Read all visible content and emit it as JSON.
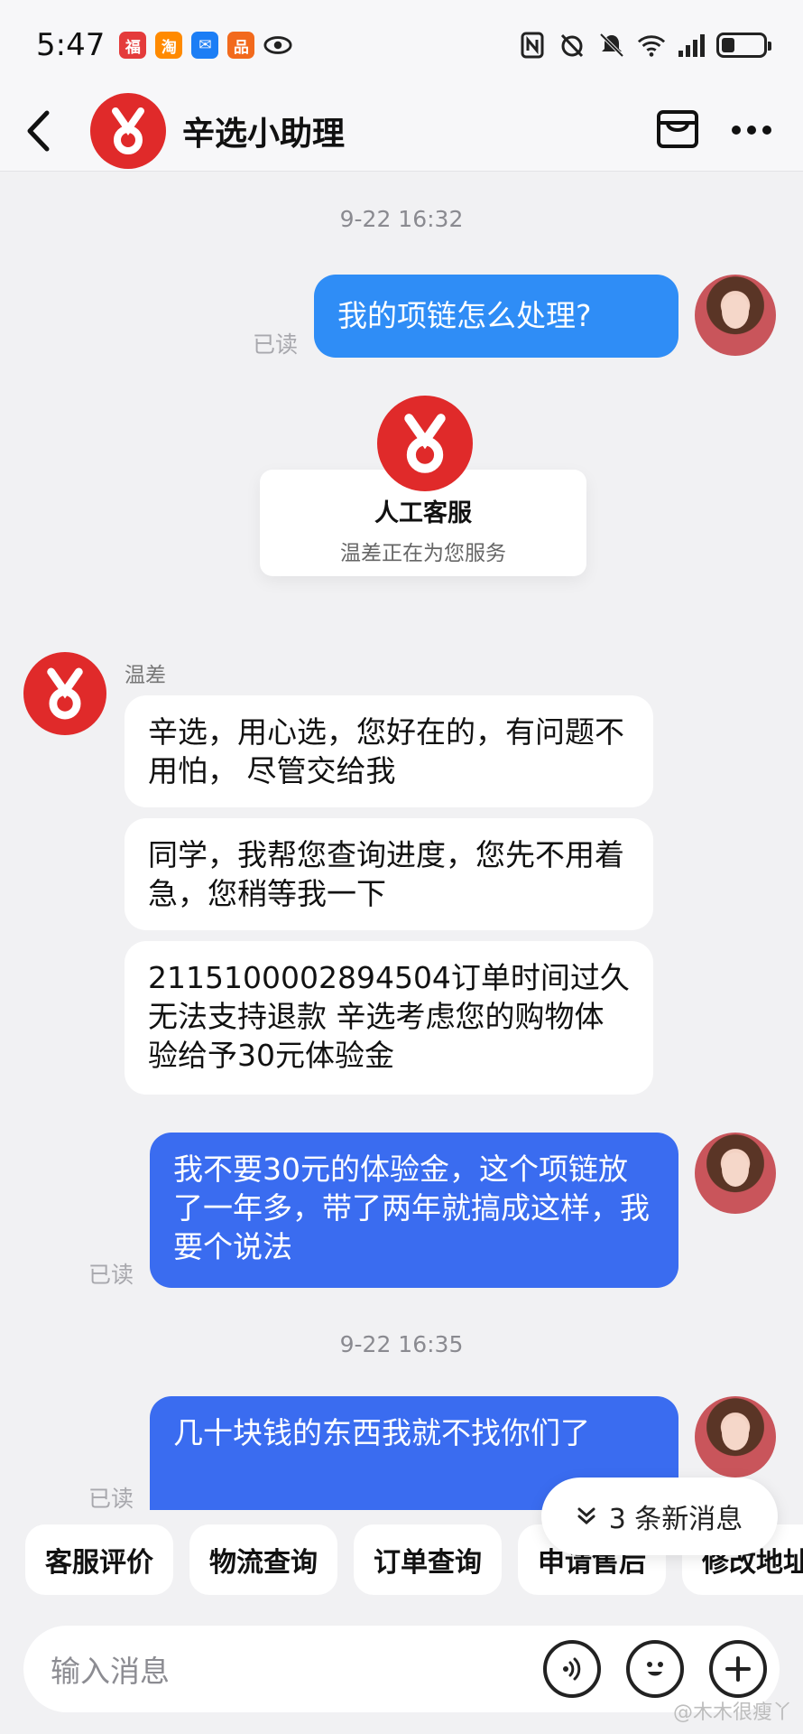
{
  "status_bar": {
    "time": "5:47",
    "apps": [
      {
        "icon": "lucky-app-icon",
        "color": "#e43b3b",
        "glyph": "福"
      },
      {
        "icon": "taobao-icon",
        "color": "#ff8a00",
        "glyph": "淘"
      },
      {
        "icon": "mail-app-icon",
        "color": "#1c7ef5",
        "glyph": "✉"
      },
      {
        "icon": "app-store-icon",
        "color": "#f26a1d",
        "glyph": "品"
      }
    ]
  },
  "nav": {
    "title": "辛选小助理"
  },
  "chat": {
    "timestamp_1": "9-22 16:32",
    "timestamp_2": "9-22 16:35",
    "read_label": "已读",
    "msg_user_1": "我的项链怎么处理?",
    "agent_card": {
      "title": "人工客服",
      "subtitle": "温差正在为您服务"
    },
    "agent_name": "温差",
    "msg_agent_1": "辛选，用心选，您好在的，有问题不用怕， 尽管交给我",
    "msg_agent_2": "同学，我帮您查询进度，您先不用着急，您稍等我一下",
    "msg_agent_3": "2115100002894504订单时间过久 无法支持退款 辛选考虑您的购物体验给予30元体验金",
    "msg_user_2": "我不要30元的体验金，这个项链放了一年多，带了两年就搞成这样，我要个说法",
    "msg_user_3": "几十块钱的东西我就不找你们了"
  },
  "new_messages": "3 条新消息",
  "quick_actions": [
    "客服评价",
    "物流查询",
    "订单查询",
    "申请售后",
    "修改地址"
  ],
  "input": {
    "placeholder": "输入消息"
  },
  "watermark": "@木木很瘦丫",
  "colors": {
    "brand_red": "#e02a2a",
    "bubble_blue": "#3a6cf0",
    "bubble_blue_light": "#2f8df6"
  }
}
